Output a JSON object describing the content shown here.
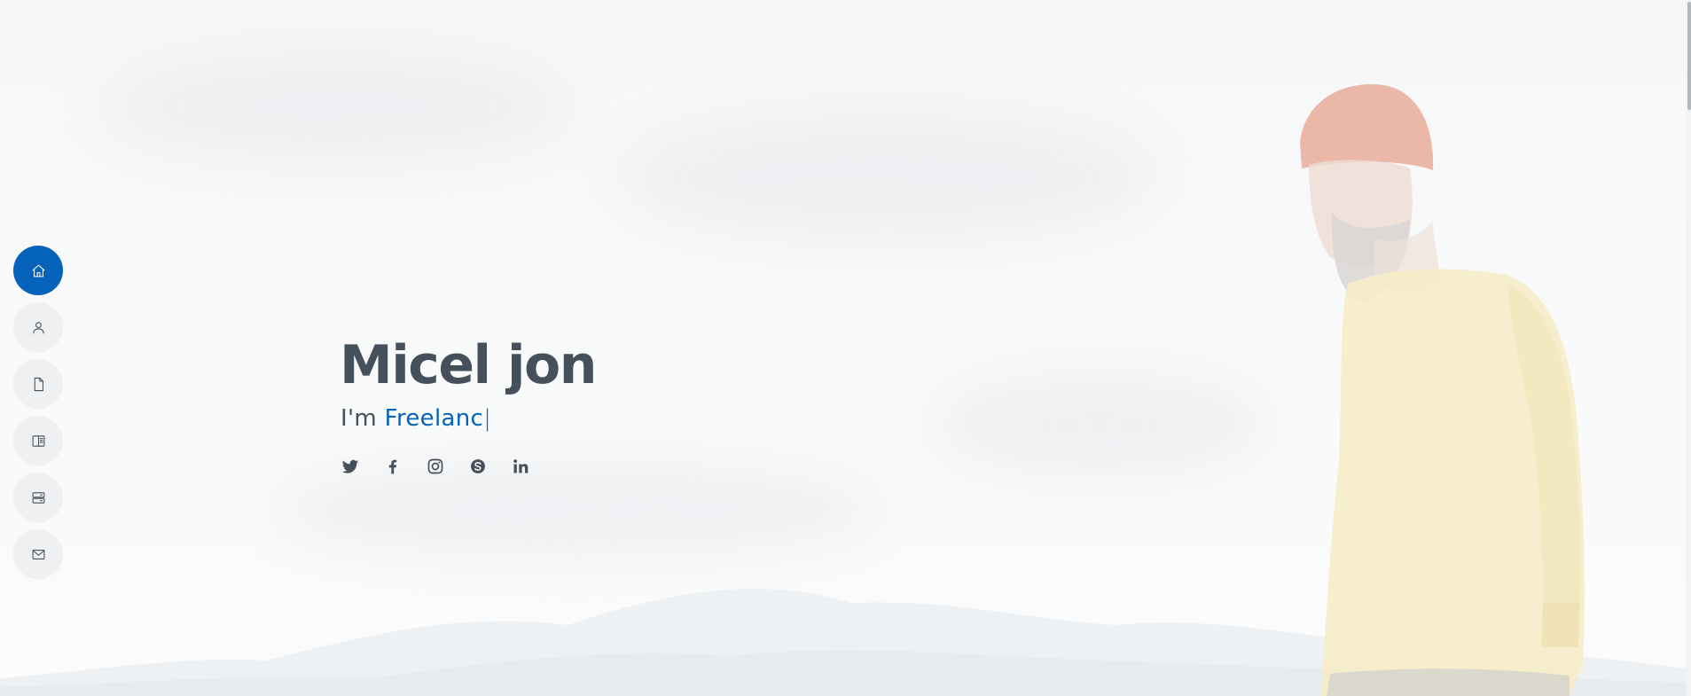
{
  "hero": {
    "name": "Micel jon",
    "tagline_prefix": "I'm ",
    "typed_text": "Freelanc",
    "cursor": "|"
  },
  "side_nav": {
    "items": [
      {
        "icon": "home-icon",
        "active": true
      },
      {
        "icon": "user-icon",
        "active": false
      },
      {
        "icon": "file-icon",
        "active": false
      },
      {
        "icon": "book-icon",
        "active": false
      },
      {
        "icon": "server-icon",
        "active": false
      },
      {
        "icon": "envelope-icon",
        "active": false
      }
    ]
  },
  "social_links": [
    {
      "icon": "twitter-icon"
    },
    {
      "icon": "facebook-icon"
    },
    {
      "icon": "instagram-icon"
    },
    {
      "icon": "skype-icon"
    },
    {
      "icon": "linkedin-icon"
    }
  ],
  "colors": {
    "accent": "#0563bb",
    "text": "#45505b",
    "nav_background": "#eef0f2",
    "page_background": "#f7f8f9"
  }
}
